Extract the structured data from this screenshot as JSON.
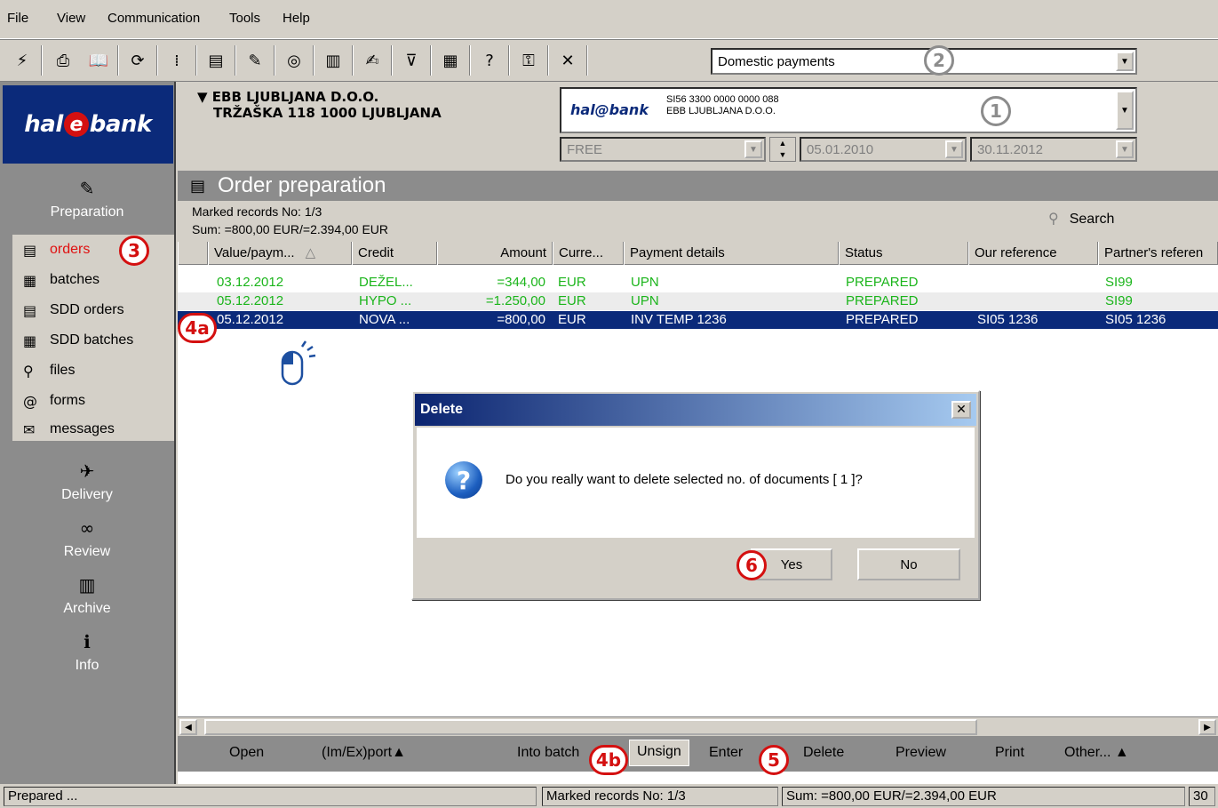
{
  "menu": [
    "File",
    "View",
    "Communication",
    "Tools",
    "Help"
  ],
  "toolbar": {
    "icons": [
      "lightning-icon",
      "print-icon",
      "book-icon",
      "refresh-icon",
      "binary-icon",
      "document-stack-icon",
      "edit-doc-icon",
      "counter-icon",
      "list-icon",
      "sign-icon",
      "filter-icon",
      "calculator-icon",
      "help-icon",
      "key-icon",
      "tools-icon"
    ],
    "glyphs": [
      "⚡",
      "⎙",
      "📖",
      "⟳",
      "⁞",
      "▤",
      "✎",
      "◎",
      "▥",
      "✍",
      "⊽",
      "▦",
      "?",
      "⚿",
      "✕"
    ],
    "view_combo": "Domestic payments"
  },
  "logo": {
    "hal": "hal",
    "e": "e",
    "bank": "bank"
  },
  "sidebar": {
    "preparation": {
      "label": "Preparation",
      "glyph": "✎"
    },
    "nav": [
      {
        "label": "orders",
        "glyph": "▤"
      },
      {
        "label": "batches",
        "glyph": "▦"
      },
      {
        "label": "SDD orders",
        "glyph": "▤"
      },
      {
        "label": "SDD batches",
        "glyph": "▦"
      },
      {
        "label": "files",
        "glyph": "⚲"
      },
      {
        "label": "forms",
        "glyph": "@"
      },
      {
        "label": "messages",
        "glyph": "✉"
      }
    ],
    "delivery": {
      "label": "Delivery",
      "glyph": "✈"
    },
    "review": {
      "label": "Review",
      "glyph": "∞"
    },
    "archive": {
      "label": "Archive",
      "glyph": "▥"
    },
    "info": {
      "label": "Info",
      "glyph": "ℹ"
    }
  },
  "company": {
    "name": "EBB LJUBLJANA D.O.O.",
    "address": "TRŽAŠKA 118 1000 LJUBLJANA"
  },
  "account": {
    "bank_logo": "hal@bank",
    "iban": "SI56 3300 0000 0000 088",
    "holder": "EBB LJUBLJANA D.O.O."
  },
  "filters": {
    "status": "FREE",
    "date_from": "05.01.2010",
    "date_to": "30.11.2012"
  },
  "content": {
    "title": "Order preparation",
    "marked": "Marked records No: 1/3",
    "sum": "Sum: =800,00 EUR/=2.394,00 EUR",
    "search": "Search"
  },
  "columns": [
    "Value/paym...",
    "Credit",
    "Amount",
    "Curre...",
    "Payment details",
    "Status",
    "Our reference",
    "Partner's referen"
  ],
  "rows": [
    {
      "date": "03.12.2012",
      "credit": "DEŽEL...",
      "amount": "=344,00",
      "currency": "EUR",
      "details": "UPN",
      "status": "PREPARED",
      "our_ref": "",
      "partner_ref": "SI99"
    },
    {
      "date": "05.12.2012",
      "credit": "HYPO ...",
      "amount": "=1.250,00",
      "currency": "EUR",
      "details": "UPN",
      "status": "PREPARED",
      "our_ref": "",
      "partner_ref": "SI99"
    },
    {
      "date": "05.12.2012",
      "credit": "NOVA ...",
      "amount": "=800,00",
      "currency": "EUR",
      "details": "INV TEMP 1236",
      "status": "PREPARED",
      "our_ref": "SI05 1236",
      "partner_ref": "SI05 1236"
    }
  ],
  "actions": {
    "open": "Open",
    "import_export": "(Im/Ex)port▲",
    "into_batch": "Into batch",
    "unsign": "Unsign",
    "enter": "Enter",
    "delete": "Delete",
    "preview": "Preview",
    "print": "Print",
    "other": "Other... ▲"
  },
  "dialog": {
    "title": "Delete",
    "message": "Do you really want to delete selected no. of documents [ 1 ]?",
    "yes": "Yes",
    "no": "No",
    "close": "✕"
  },
  "badges": {
    "b1": "1",
    "b2": "2",
    "b3": "3",
    "b4a": "4a",
    "b4b": "4b",
    "b5": "5",
    "b6": "6"
  },
  "status": {
    "left": "Prepared ...",
    "marked": "Marked records No: 1/3",
    "sum": "Sum: =800,00 EUR/=2.394,00 EUR",
    "right": "30"
  },
  "colors": {
    "accent_red": "#d41010",
    "navy": "#0b2a7a",
    "green": "#1bb51b"
  }
}
